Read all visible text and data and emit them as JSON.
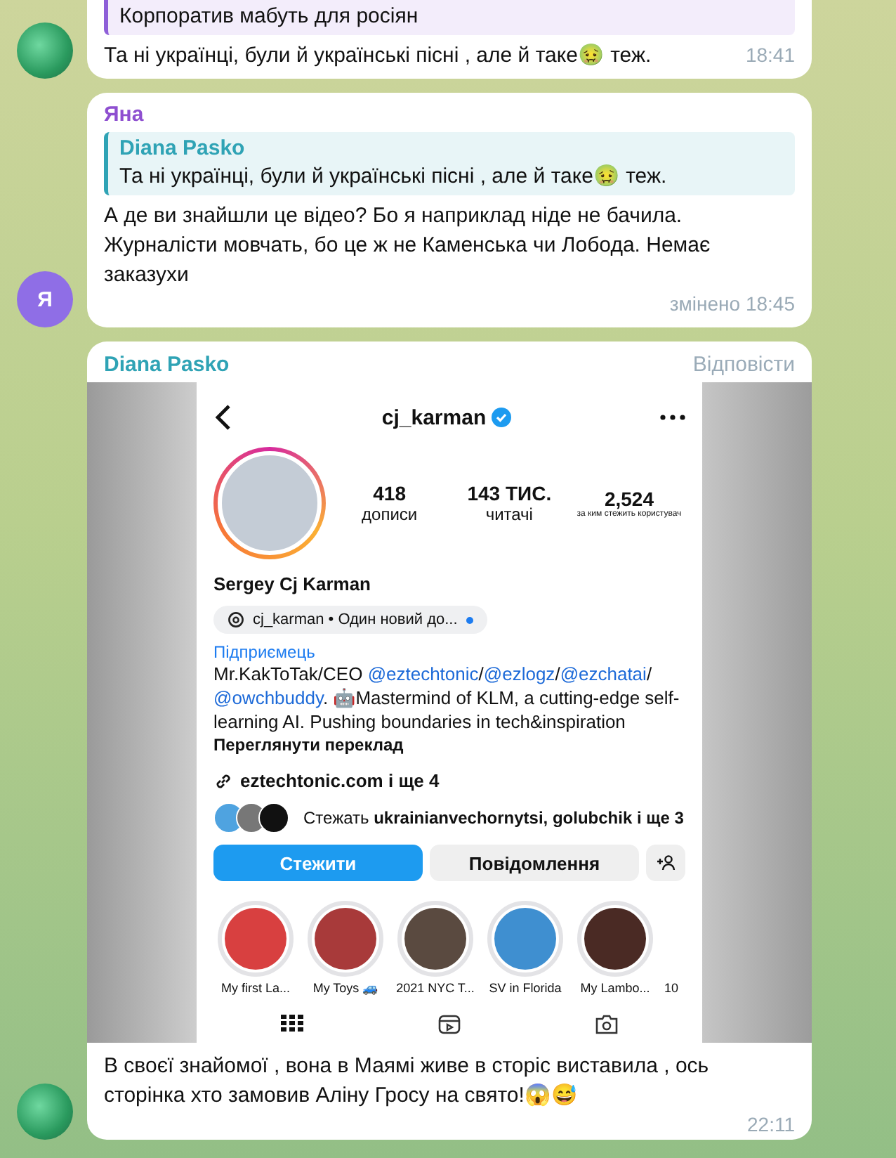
{
  "messages": [
    {
      "kind": "text",
      "avatar": {
        "kind": "photo"
      },
      "reply": {
        "text": "Корпоратив мабуть для росіян",
        "color": "#8e5fd8"
      },
      "text": "Та ні українці, були й українські пісні , але й таке🤢 теж.",
      "time": "18:41"
    },
    {
      "kind": "text",
      "avatar": {
        "kind": "letter",
        "letter": "Я",
        "color": "#8f6ee6"
      },
      "sender": {
        "name": "Яна",
        "color": "#8e4fd0"
      },
      "reply": {
        "author": "Diana Pasko",
        "text": "Та ні українці, були й українські пісні , але й таке🤢 теж.",
        "color": "#2fa3b5"
      },
      "text": "А де ви знайшли це відео? Бо я наприклад ніде не бачила. Журналісти мовчать, бо це ж не Каменська чи Лобода. Немає заказухи",
      "time": "змінено 18:45"
    },
    {
      "kind": "media",
      "avatar": {
        "kind": "photo"
      },
      "sender": {
        "name": "Diana Pasko",
        "color": "#2fa3b5"
      },
      "reply_action": "Відповісти",
      "text": "В своєї знайомої , вона в Маямі живе в сторіс виставила , ось сторінка хто замовив Аліну Гросу на свято!😱😅",
      "time": "22:11",
      "screenshot": {
        "username": "cj_karman",
        "verified": true,
        "stats": [
          {
            "value": "418",
            "label": "дописи"
          },
          {
            "value": "143 ТИС.",
            "label": "читачі"
          },
          {
            "value": "2,524",
            "label": "за ким стежить користувач"
          }
        ],
        "name": "Sergey Cj Karman",
        "threads_badge": "cj_karman • Один новий до...",
        "category": "Підприємець",
        "bio": [
          {
            "text": "Mr.KakToTak/CEO ",
            "link": false
          },
          {
            "text": "@eztechtonic",
            "link": true
          },
          {
            "text": "/",
            "link": false
          },
          {
            "text": "@ezlogz",
            "link": true
          },
          {
            "text": "/",
            "link": false
          },
          {
            "text": "@ezchatai",
            "link": true
          },
          {
            "text": "/ ",
            "link": false
          },
          {
            "text": "@owchbuddy",
            "link": true
          },
          {
            "text": ". 🤖Mastermind of KLM, a cutting-edge self-learning AI. Pushing boundaries in tech&inspiration",
            "link": false
          }
        ],
        "see_translation": "Переглянути переклад",
        "website": "eztechtonic.com і ще 4",
        "followed_by": "Стежать **ukrainianvechornytsi, golubchik і ще 3**",
        "buttons": [
          "Стежити",
          "Повідомлення"
        ],
        "highlights": [
          {
            "label": "My first La...",
            "color": "#d84040"
          },
          {
            "label": "My Toys 🚙",
            "color": "#a83a3a"
          },
          {
            "label": "2021 NYC T...",
            "color": "#5a4a40"
          },
          {
            "label": "SV in Florida",
            "color": "#3f8fd0"
          },
          {
            "label": "My Lambo...",
            "color": "#4a2a24"
          },
          {
            "label": "10"
          }
        ]
      }
    }
  ]
}
